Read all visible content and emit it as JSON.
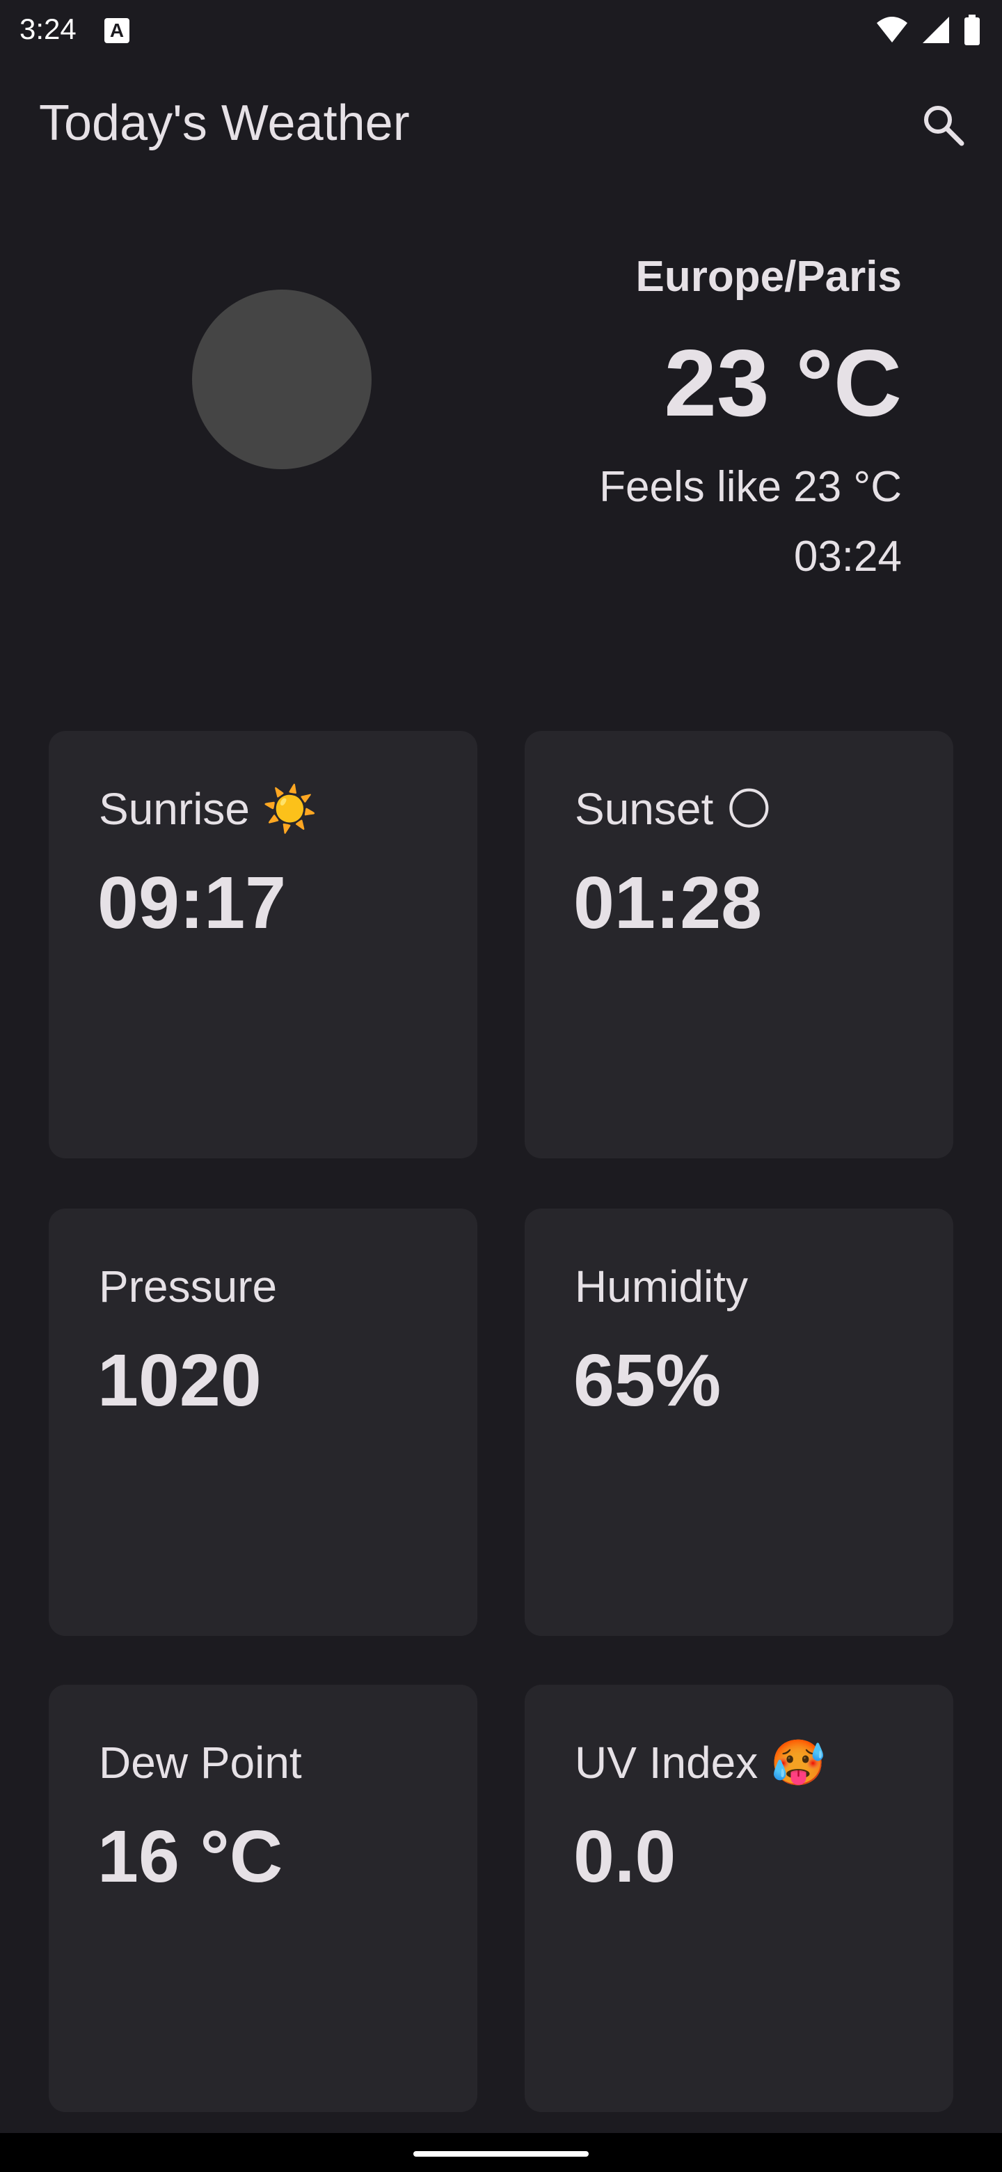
{
  "status_bar": {
    "time": "3:24",
    "notification_icon": "a-icon",
    "icons": [
      "wifi-icon",
      "signal-icon",
      "battery-icon"
    ]
  },
  "app_bar": {
    "title": "Today's Weather",
    "search_icon": "search-icon"
  },
  "current": {
    "location": "Europe/Paris",
    "temperature": "23 °C",
    "feels_like": "Feels like 23 °C",
    "time": "03:24"
  },
  "cards": [
    {
      "label": "Sunrise ☀️",
      "value": "09:17"
    },
    {
      "label": "Sunset 🌕",
      "value": "01:28"
    },
    {
      "label": "Pressure",
      "value": "1020"
    },
    {
      "label": "Humidity",
      "value": "65%"
    },
    {
      "label": "Dew Point",
      "value": "16 °C"
    },
    {
      "label": "UV Index 🥵",
      "value": "0.0"
    }
  ],
  "colors": {
    "background": "#1c1b20",
    "card": "#27262b",
    "text": "#e6e1e6",
    "placeholder": "#454545"
  }
}
